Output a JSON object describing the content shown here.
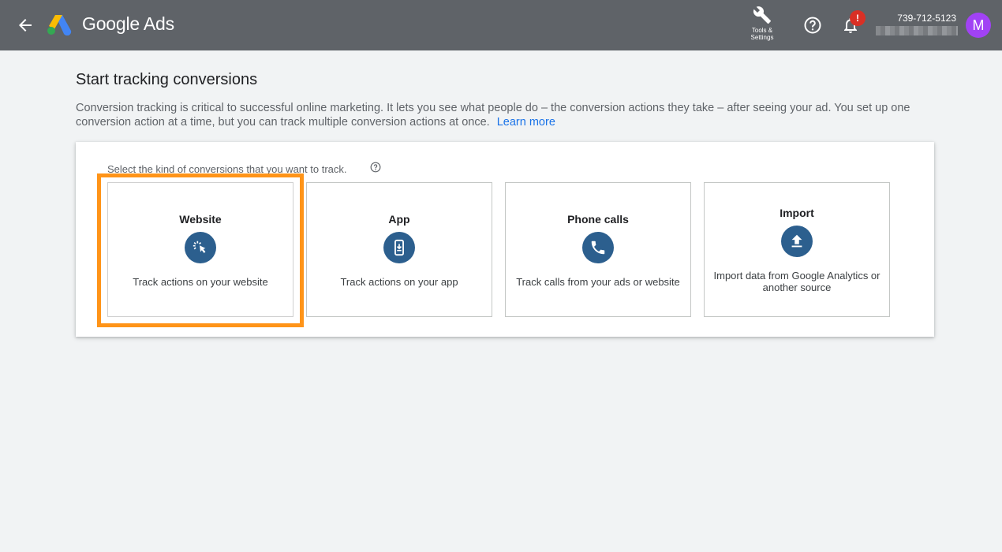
{
  "header": {
    "brand": "Google Ads",
    "tools_label": "Tools &\nSettings",
    "notification_badge": "!",
    "account_id": "739-712-5123",
    "avatar_letter": "M"
  },
  "main": {
    "title": "Start tracking conversions",
    "intro": "Conversion tracking is critical to successful online marketing. It lets you see what people do – the conversion actions they take – after seeing your ad. You set up one conversion action at a time, but you can track multiple conversion actions at once.",
    "learn_more": "Learn more",
    "select_prompt": "Select the kind of conversions that you want to track.",
    "options": [
      {
        "title": "Website",
        "icon": "cursor-click-icon",
        "description": "Track actions on your website"
      },
      {
        "title": "App",
        "icon": "phone-download-icon",
        "description": "Track actions on your app"
      },
      {
        "title": "Phone calls",
        "icon": "phone-call-icon",
        "description": "Track calls from your ads or website"
      },
      {
        "title": "Import",
        "icon": "upload-icon",
        "description": "Import data from Google Analytics or another source"
      }
    ]
  },
  "colors": {
    "topbar": "#5f6368",
    "icon_circle": "#2c5f8e",
    "highlight": "#ff9418",
    "link": "#1a73e8",
    "avatar": "#a142f4"
  }
}
